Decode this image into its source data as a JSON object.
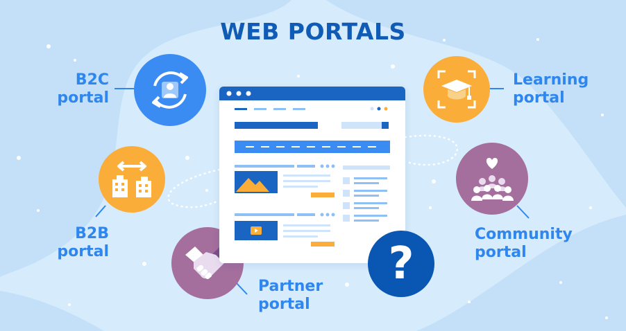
{
  "title": "WEB PORTALS",
  "portals": {
    "b2c": {
      "line1": "B2C",
      "line2": "portal",
      "icon": "refresh-user-icon",
      "color": "#3a8cf3"
    },
    "b2b": {
      "line1": "B2B",
      "line2": "portal",
      "icon": "buildings-icon",
      "color": "#fbad3a"
    },
    "partner": {
      "line1": "Partner",
      "line2": "portal",
      "icon": "handshake-icon",
      "color": "#a46e9d"
    },
    "learning": {
      "line1": "Learning",
      "line2": "portal",
      "icon": "graduation-cap-icon",
      "color": "#fbad3a"
    },
    "community": {
      "line1": "Community",
      "line2": "portal",
      "icon": "community-icon",
      "color": "#a46e9d"
    }
  },
  "help": {
    "icon": "question-mark-icon",
    "glyph": "?",
    "color": "#0a56b3"
  },
  "colors": {
    "label": "#2e86ee",
    "title": "#0f5bb5",
    "background": "#d6ebfb",
    "browser_bar": "#1a64c2"
  }
}
